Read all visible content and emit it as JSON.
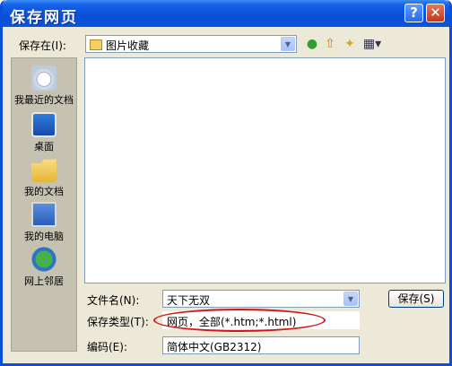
{
  "window": {
    "title": "保存网页",
    "help_label": "?",
    "close_label": "✕"
  },
  "save_in": {
    "label": "保存在(I):",
    "value": "图片收藏"
  },
  "toolbar": {
    "back_icon": "back-arrow-icon",
    "up_icon": "up-folder-icon",
    "new_folder_icon": "new-folder-icon",
    "views_icon": "views-menu-icon"
  },
  "places": [
    {
      "label": "我最近的文档",
      "icon": "recent-documents-icon"
    },
    {
      "label": "桌面",
      "icon": "desktop-icon"
    },
    {
      "label": "我的文档",
      "icon": "my-documents-icon"
    },
    {
      "label": "我的电脑",
      "icon": "my-computer-icon"
    },
    {
      "label": "网上邻居",
      "icon": "network-places-icon"
    }
  ],
  "file_name": {
    "label": "文件名(N):",
    "value": "天下无双"
  },
  "save_type": {
    "label": "保存类型(T):",
    "value": "网页，全部(*.htm;*.html)"
  },
  "encoding": {
    "label": "编码(E):",
    "value": "简体中文(GB2312)"
  },
  "save_button": {
    "label": "保存(S)"
  },
  "colors": {
    "titlebar": "#0a4fd8",
    "dialog_bg": "#ece9d8",
    "highlight_ellipse": "#d01818"
  }
}
